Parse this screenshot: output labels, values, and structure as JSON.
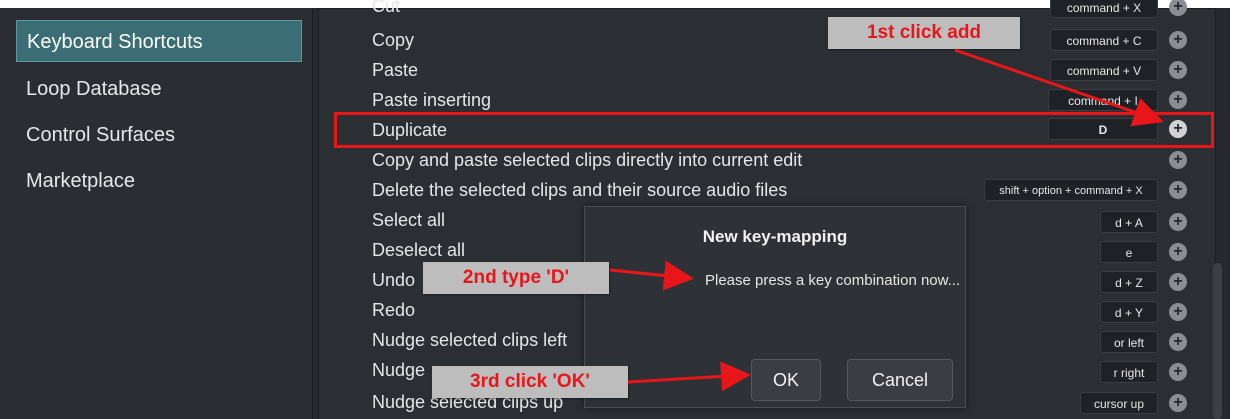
{
  "sidebar": {
    "items": [
      {
        "label": "Keyboard Shortcuts",
        "active": true
      },
      {
        "label": "Loop Database",
        "active": false
      },
      {
        "label": "Control Surfaces",
        "active": false
      },
      {
        "label": "Marketplace",
        "active": false
      }
    ]
  },
  "shortcuts": {
    "rows": [
      {
        "label": "Cut",
        "key": "command + X"
      },
      {
        "label": "Copy",
        "key": "command + C"
      },
      {
        "label": "Paste",
        "key": "command + V"
      },
      {
        "label": "Paste inserting",
        "key": "command + I"
      },
      {
        "label": "Duplicate",
        "key": "D"
      },
      {
        "label": "Copy and paste selected clips directly into current edit",
        "key": ""
      },
      {
        "label": "Delete the selected clips and their source audio files",
        "key": "shift + option + command + X"
      },
      {
        "label": "Select all",
        "key": "d + A"
      },
      {
        "label": "Deselect all",
        "key": "e"
      },
      {
        "label": "Undo",
        "key": "d + Z"
      },
      {
        "label": "Redo",
        "key": "d + Y"
      },
      {
        "label": "Nudge selected clips left",
        "key": "or left"
      },
      {
        "label": "Nudge",
        "key": "r right"
      },
      {
        "label": "Nudge selected clips up",
        "key": "cursor up"
      }
    ],
    "add_symbol": "+"
  },
  "dialog": {
    "title": "New key-mapping",
    "message": "Please press a key combination now...",
    "ok_label": "OK",
    "cancel_label": "Cancel"
  },
  "annotations": {
    "step1": "1st click add",
    "step2": "2nd type 'D'",
    "step3": "3rd click 'OK'",
    "color": "#e8151b"
  }
}
